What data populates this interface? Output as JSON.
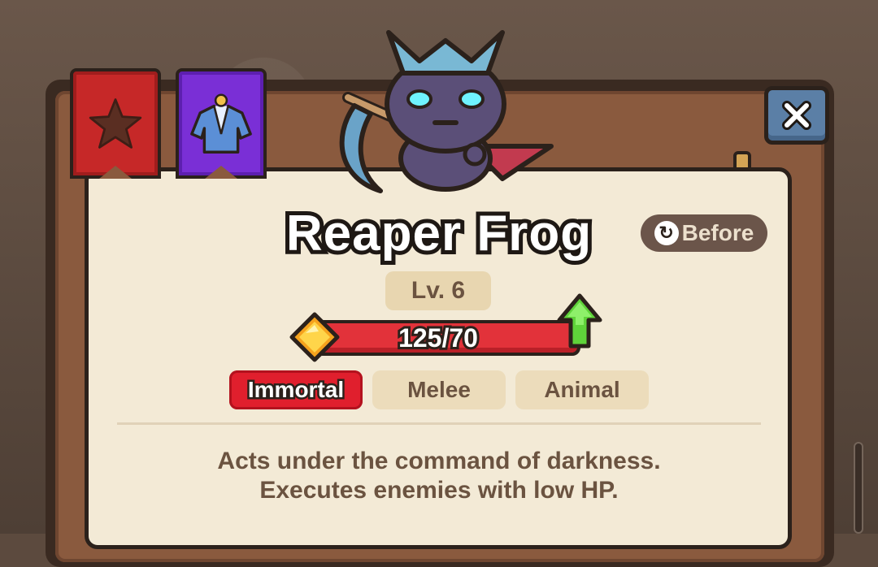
{
  "character": {
    "name": "Reaper Frog",
    "level_label": "Lv. 6",
    "exp_text": "125/70",
    "exp_fraction": 1.0,
    "level_up_available": true,
    "tags": [
      "Immortal",
      "Melee",
      "Animal"
    ],
    "description_line1": "Acts under the command of darkness.",
    "description_line2": "Executes enemies with low HP."
  },
  "buttons": {
    "before_label": "Before",
    "close_icon": "close-icon"
  },
  "banners": [
    {
      "name": "favorite-banner",
      "icon": "star-icon",
      "color": "#c62828"
    },
    {
      "name": "costume-banner",
      "icon": "robe-icon",
      "color": "#7a2fd6"
    }
  ],
  "colors": {
    "exp_bar": "#e2323a",
    "tag_highlight": "#e01f2d",
    "upgrade_arrow": "#5fd33a",
    "close_button": "#5b7fa6"
  }
}
